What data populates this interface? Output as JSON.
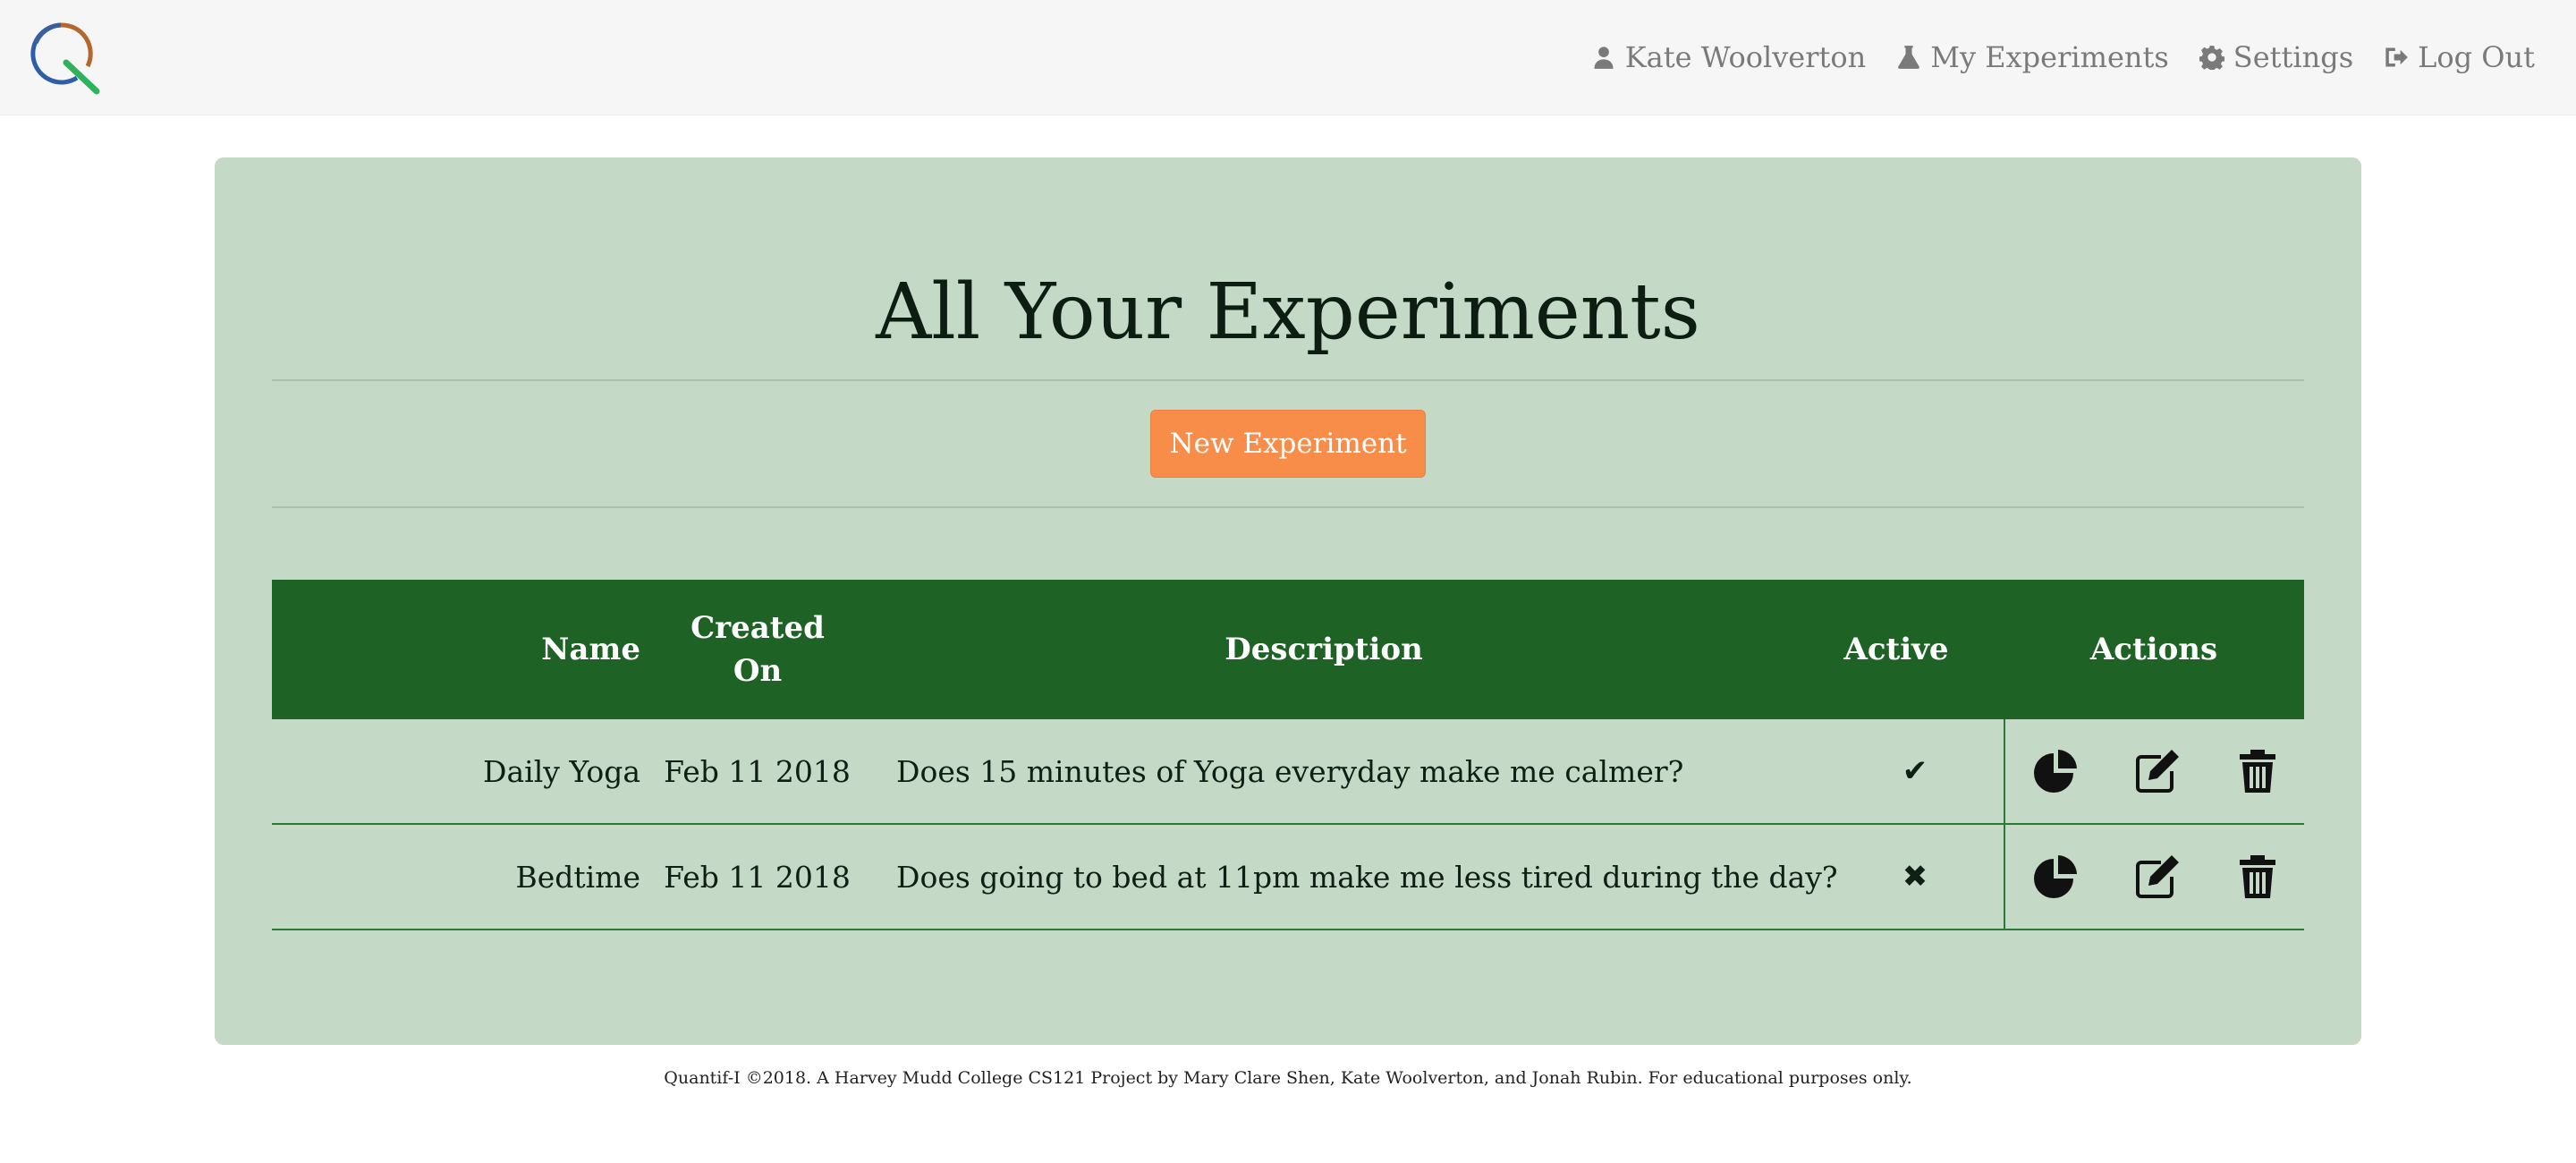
{
  "nav": {
    "user": "Kate Woolverton",
    "experiments": "My Experiments",
    "settings": "Settings",
    "logout": "Log Out"
  },
  "page": {
    "title": "All Your Experiments",
    "new_button": "New Experiment"
  },
  "table": {
    "headers": {
      "name": "Name",
      "created_line1": "Created",
      "created_line2": "On",
      "description": "Description",
      "active": "Active",
      "actions": "Actions"
    },
    "rows": [
      {
        "name": "Daily Yoga",
        "created": "Feb 11 2018",
        "description": "Does 15 minutes of Yoga everyday make me calmer?",
        "active_mark": "✔"
      },
      {
        "name": "Bedtime",
        "created": "Feb 11 2018",
        "description": "Does going to bed at 11pm make me less tired during the day?",
        "active_mark": "✖"
      }
    ]
  },
  "footer": "Quantif-I ©2018. A Harvey Mudd College CS121 Project by Mary Clare Shen, Kate Woolverton, and Jonah Rubin. For educational purposes only.",
  "colors": {
    "panel": "#c4dac6",
    "table_header": "#1e6325",
    "button": "#f88d49"
  }
}
